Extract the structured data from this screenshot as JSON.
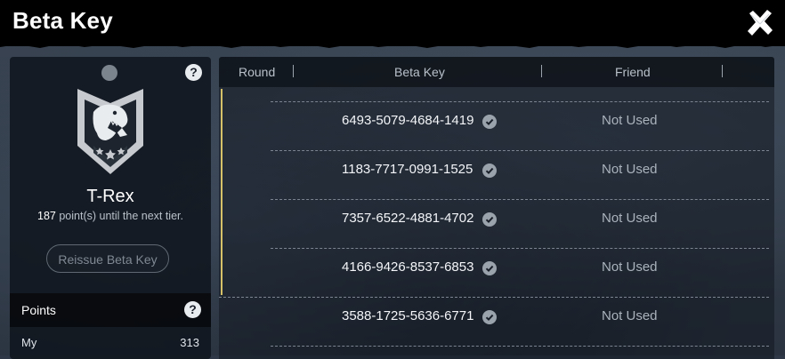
{
  "header": {
    "title": "Beta Key",
    "close_icon": "close-x-icon"
  },
  "left_panel": {
    "help_icon": "question-icon",
    "badge_icon": "t-rex-shield-badge-icon",
    "tier_name": "T-Rex",
    "points_until_next": "187",
    "tier_note_suffix": " point(s) until the next tier.",
    "reissue_button_label": "Reissue Beta Key",
    "points_header": "Points",
    "points_rows": [
      {
        "label": "My",
        "value": "313"
      }
    ]
  },
  "table": {
    "columns": [
      "Round",
      "Beta Key",
      "Friend"
    ],
    "rows": [
      {
        "key": "6493-5079-4684-1419",
        "friend": "Not Used"
      },
      {
        "key": "1183-7717-0991-1525",
        "friend": "Not Used"
      },
      {
        "key": "7357-6522-4881-4702",
        "friend": "Not Used"
      },
      {
        "key": "4166-9426-8537-6853",
        "friend": "Not Used"
      },
      {
        "key": "3588-1725-5636-6771",
        "friend": "Not Used"
      }
    ]
  },
  "colors": {
    "accent": "#d6c168",
    "topbar": "#000000",
    "panel": "#10161e"
  }
}
